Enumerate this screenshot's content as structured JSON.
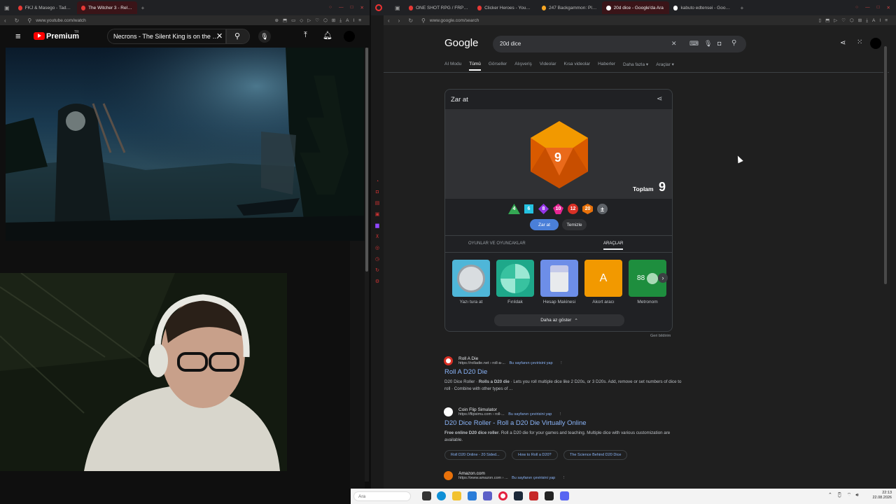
{
  "left_browser": {
    "tabs": [
      {
        "label": "FKJ & Masego - Tadow - Y"
      },
      {
        "label": "The Witcher 3 - Relax..."
      }
    ],
    "url": "www.youtube.com/watch"
  },
  "youtube": {
    "logo_text": "Premium",
    "logo_badge": "TR",
    "search_value": "Necrons - The Silent King is on the Flo"
  },
  "right_browser": {
    "tabs": [
      {
        "label": "ONE SHOT RPG / FRP \" Gi"
      },
      {
        "label": "Clicker Heroes - YouTube"
      },
      {
        "label": "247 Backgammon: Play O"
      },
      {
        "label": "20d dice - Google'da Ara"
      },
      {
        "label": "kabuto edtensei - Google'"
      }
    ],
    "url": "www.google.com/search"
  },
  "google": {
    "logo": "Google",
    "query": "20d dice",
    "tabs": [
      "AI Modu",
      "Tümü",
      "Görseller",
      "Alışveriş",
      "Videolar",
      "Kısa videolar",
      "Haberler",
      "Daha fazla",
      "Araçlar"
    ],
    "dice_roller": {
      "title": "Zar at",
      "die_value": "9",
      "total_label": "Toplam",
      "total_value": "9",
      "dice_options": [
        {
          "label": "4",
          "color": "#34a853"
        },
        {
          "label": "6",
          "color": "#24c1e0"
        },
        {
          "label": "8",
          "color": "#9334e6"
        },
        {
          "label": "10",
          "color": "#e52592"
        },
        {
          "label": "12",
          "color": "#d93025"
        },
        {
          "label": "20",
          "color": "#e8710a"
        }
      ],
      "roll_button": "Zar at",
      "clear_button": "Temizle",
      "category_tabs": [
        "OYUNLAR VE OYUNCAKLAR",
        "ARAÇLAR"
      ],
      "tools": [
        {
          "label": "Yazı tura at",
          "color": "#4fb6d8"
        },
        {
          "label": "Fırıldak",
          "color": "#1ea88a"
        },
        {
          "label": "Hesap Makinesi",
          "color": "#6d8ee8"
        },
        {
          "label": "Akort aracı",
          "color": "#f29900"
        },
        {
          "label": "Metronom",
          "color": "#1e8e3e"
        }
      ],
      "tool_tile_glyphs": [
        "A",
        "88"
      ],
      "show_less": "Daha az göster",
      "feedback": "Geri bildirim"
    },
    "results": [
      {
        "site": "Roll A Die",
        "url": "https://rolladie.net › roll-a-...",
        "translate": "Bu sayfanın çevirisini yap",
        "title": "Roll A D20 Die",
        "snippet_prefix": "D20 Dice Roller · ",
        "snippet_bold": "Rolls a D20 die",
        "snippet_rest": " · Lets you roll multiple dice like 2 D20s, or 3 D20s. Add, remove or set numbers of dice to roll · Combine with other types of ..."
      },
      {
        "site": "Coin Flip Simulator",
        "url": "https://flipsimu.com › roll-...",
        "translate": "Bu sayfanın çevirisini yap",
        "title": "D20 Dice Roller - Roll a D20 Die Virtually Online",
        "snippet_bold": "Free online D20 dice roller",
        "snippet_rest": ". Roll a D20 die for your games and teaching. Multiple dice with various customization are available.",
        "chips": [
          "Roll D20 Online - 20 Sided...",
          "How to Roll a D20?",
          "The Science Behind D20 Dice"
        ]
      },
      {
        "site": "Amazon.com",
        "url": "https://www.amazon.com › ...",
        "translate": "Bu sayfanın çevirisini yap"
      }
    ]
  },
  "taskbar": {
    "search_placeholder": "Ara",
    "time": "22:13",
    "date": "22.08.2026"
  }
}
